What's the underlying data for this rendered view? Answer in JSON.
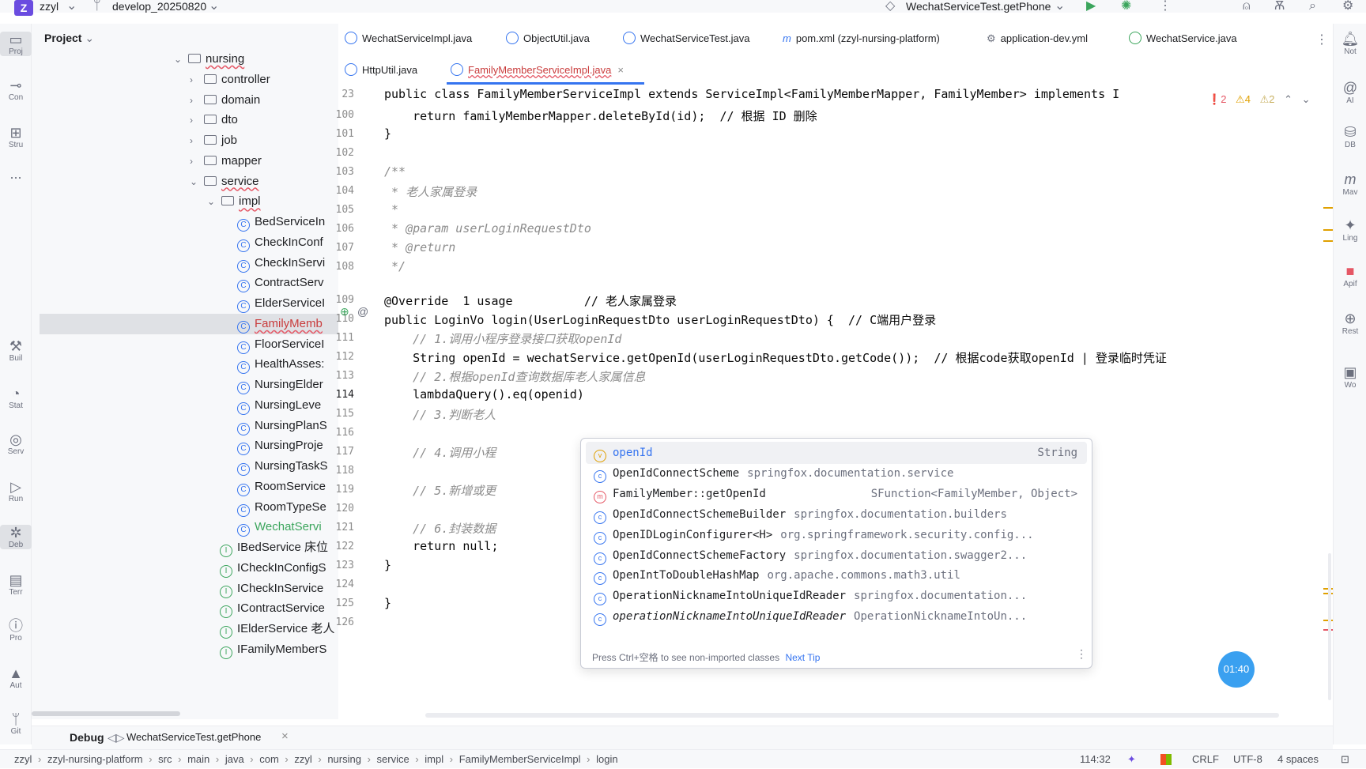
{
  "titlebar": {
    "project_badge": "Z",
    "project_name": "zzyl",
    "branch": "develop_20250820",
    "run_config": "WechatServiceTest.getPhone"
  },
  "left_strip": [
    {
      "icon": "folder-icon",
      "label": "Proj"
    },
    {
      "icon": "commit-icon",
      "label": "Con"
    },
    {
      "icon": "structure-icon",
      "label": "Stru"
    },
    {
      "icon": "more-icon",
      "label": "..."
    },
    {
      "icon": "build-icon",
      "label": "Buil"
    },
    {
      "icon": "statistic-icon",
      "label": "Stat"
    },
    {
      "icon": "services-icon",
      "label": "Serv"
    },
    {
      "icon": "run-icon",
      "label": "Run"
    },
    {
      "icon": "debug-icon",
      "label": "Deb"
    },
    {
      "icon": "terminal-icon",
      "label": "Terr"
    },
    {
      "icon": "problems-icon",
      "label": "Pro"
    },
    {
      "icon": "auto-icon",
      "label": "Aut"
    },
    {
      "icon": "git-icon",
      "label": "Git"
    }
  ],
  "project_panel": {
    "title": "Project",
    "tree": [
      {
        "label": "nursing",
        "kind": "folder",
        "expanded": true
      },
      {
        "label": "controller",
        "kind": "folder"
      },
      {
        "label": "domain",
        "kind": "folder"
      },
      {
        "label": "dto",
        "kind": "folder"
      },
      {
        "label": "job",
        "kind": "folder"
      },
      {
        "label": "mapper",
        "kind": "folder"
      },
      {
        "label": "service",
        "kind": "folder",
        "expanded": true
      },
      {
        "label": "impl",
        "kind": "folder",
        "expanded": true
      },
      {
        "label": "BedServiceIn",
        "kind": "class"
      },
      {
        "label": "CheckInConf",
        "kind": "class"
      },
      {
        "label": "CheckInServi",
        "kind": "class"
      },
      {
        "label": "ContractServ",
        "kind": "class"
      },
      {
        "label": "ElderServiceI",
        "kind": "class"
      },
      {
        "label": "FamilyMemb",
        "kind": "class",
        "selected": true
      },
      {
        "label": "FloorServiceI",
        "kind": "class"
      },
      {
        "label": "HealthAsses:",
        "kind": "class"
      },
      {
        "label": "NursingElder",
        "kind": "class"
      },
      {
        "label": "NursingLeve",
        "kind": "class"
      },
      {
        "label": "NursingPlanS",
        "kind": "class"
      },
      {
        "label": "NursingProje",
        "kind": "class"
      },
      {
        "label": "NursingTaskS",
        "kind": "class"
      },
      {
        "label": "RoomService",
        "kind": "class"
      },
      {
        "label": "RoomTypeSe",
        "kind": "class"
      },
      {
        "label": "WechatServi",
        "kind": "class",
        "modified": true
      },
      {
        "label": "IBedService 床位",
        "kind": "interface"
      },
      {
        "label": "ICheckInConfigS",
        "kind": "interface"
      },
      {
        "label": "ICheckInService",
        "kind": "interface"
      },
      {
        "label": "IContractService",
        "kind": "interface"
      },
      {
        "label": "IElderService 老人",
        "kind": "interface"
      },
      {
        "label": "IFamilyMemberS",
        "kind": "interface"
      }
    ]
  },
  "tabs_row1": [
    {
      "label": "WechatServiceImpl.java"
    },
    {
      "label": "ObjectUtil.java"
    },
    {
      "label": "WechatServiceTest.java"
    },
    {
      "label": "pom.xml (zzyl-nursing-platform)"
    },
    {
      "label": "application-dev.yml"
    },
    {
      "label": "WechatService.java"
    }
  ],
  "tabs_row2": [
    {
      "label": "HttpUtil.java"
    },
    {
      "label": "FamilyMemberServiceImpl.java",
      "active": true
    }
  ],
  "editor": {
    "inspection": {
      "errors": "2",
      "warnings": "4",
      "weak": "2"
    },
    "lines": [
      {
        "n": "23",
        "text": "public class FamilyMemberServiceImpl extends ServiceImpl<FamilyMemberMapper, FamilyMember> implements I"
      },
      {
        "n": "100",
        "text": "    return familyMemberMapper.deleteById(id);  // 根据 ID 删除"
      },
      {
        "n": "101",
        "text": "}"
      },
      {
        "n": "102",
        "text": ""
      },
      {
        "n": "103",
        "text": "/**"
      },
      {
        "n": "104",
        "text": " * 老人家属登录"
      },
      {
        "n": "105",
        "text": " *"
      },
      {
        "n": "106",
        "text": " * @param userLoginRequestDto"
      },
      {
        "n": "107",
        "text": " * @return"
      },
      {
        "n": "108",
        "text": " */"
      },
      {
        "n": "109",
        "text": "@Override  1 usage          // 老人家属登录"
      },
      {
        "n": "110",
        "text": "public LoginVo login(UserLoginRequestDto userLoginRequestDto) {  // C端用户登录"
      },
      {
        "n": "111",
        "text": "    // 1.调用小程序登录接口获取openId"
      },
      {
        "n": "112",
        "text": "    String openId = wechatService.getOpenId(userLoginRequestDto.getCode());  // 根据code获取openId | 登录临时凭证"
      },
      {
        "n": "113",
        "text": "    // 2.根据openId查询数据库老人家属信息"
      },
      {
        "n": "114",
        "text": "    lambdaQuery().eq(openid)"
      },
      {
        "n": "115",
        "text": "    // 3.判断老人"
      },
      {
        "n": "116",
        "text": ""
      },
      {
        "n": "117",
        "text": "    // 4.调用小程"
      },
      {
        "n": "118",
        "text": ""
      },
      {
        "n": "119",
        "text": "    // 5.新增或更"
      },
      {
        "n": "120",
        "text": ""
      },
      {
        "n": "121",
        "text": "    // 6.封装数据"
      },
      {
        "n": "122",
        "text": "    return null;"
      },
      {
        "n": "123",
        "text": "}"
      },
      {
        "n": "124",
        "text": ""
      },
      {
        "n": "125",
        "text": "}"
      },
      {
        "n": "126",
        "text": ""
      }
    ]
  },
  "completion": {
    "items": [
      {
        "icon": "v",
        "name": "openId",
        "detail": "String",
        "selected": true
      },
      {
        "icon": "c",
        "name": "OpenIdConnectScheme",
        "detail": "springfox.documentation.service"
      },
      {
        "icon": "m",
        "name": "FamilyMember::getOpenId",
        "detail": "SFunction<FamilyMember, Object>"
      },
      {
        "icon": "c",
        "name": "OpenIdConnectSchemeBuilder",
        "detail": "springfox.documentation.builders"
      },
      {
        "icon": "c",
        "name": "OpenIDLoginConfigurer<H>",
        "detail": "org.springframework.security.config..."
      },
      {
        "icon": "c",
        "name": "OpenIdConnectSchemeFactory",
        "detail": "springfox.documentation.swagger2..."
      },
      {
        "icon": "c",
        "name": "OpenIntToDoubleHashMap",
        "detail": "org.apache.commons.math3.util"
      },
      {
        "icon": "c",
        "name": "OperationNicknameIntoUniqueIdReader",
        "detail": "springfox.documentation..."
      },
      {
        "icon": "c",
        "name": "operationNicknameIntoUniqueIdReader",
        "detail": "OperationNicknameIntoUn..."
      }
    ],
    "footer": "Press Ctrl+空格 to see non-imported classes",
    "next_tip": "Next Tip"
  },
  "right_strip": [
    {
      "icon": "notifications-icon",
      "label": "Not"
    },
    {
      "icon": "ai-icon",
      "label": "AI"
    },
    {
      "icon": "database-icon",
      "label": "DB"
    },
    {
      "icon": "maven-icon",
      "label": "Mav"
    },
    {
      "icon": "lingma-icon",
      "label": "Ling"
    },
    {
      "icon": "apifox-icon",
      "label": "Apif"
    },
    {
      "icon": "rest-icon",
      "label": "Rest"
    },
    {
      "icon": "word-icon",
      "label": "Wo"
    }
  ],
  "debug_bar": {
    "title": "Debug",
    "session": "WechatServiceTest.getPhone"
  },
  "timer": "01:40",
  "status_bar": {
    "breadcrumb": [
      "zzyl",
      "zzyl-nursing-platform",
      "src",
      "main",
      "java",
      "com",
      "zzyl",
      "nursing",
      "service",
      "impl",
      "FamilyMemberServiceImpl",
      "login"
    ],
    "position": "114:32",
    "line_sep": "CRLF",
    "encoding": "UTF-8",
    "indent": "4 spaces"
  }
}
